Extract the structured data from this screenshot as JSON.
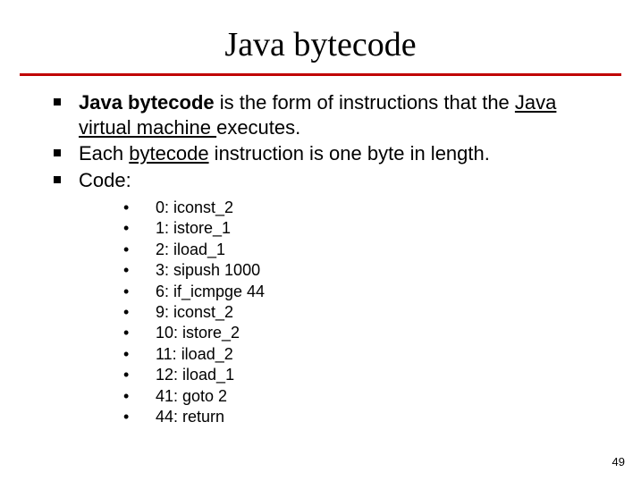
{
  "title": "Java bytecode",
  "bullets": {
    "b1": {
      "bold": "Java bytecode",
      "rest1": " is the form of instructions that the ",
      "link": "Java virtual machine ",
      "rest2": "executes."
    },
    "b2": {
      "pre": "Each ",
      "link": "bytecode",
      "post": " instruction is one byte in length."
    },
    "b3": "Code:"
  },
  "code": [
    "0: iconst_2",
    "1: istore_1",
    "2: iload_1",
    "3: sipush 1000",
    "6: if_icmpge 44",
    "9: iconst_2",
    "10: istore_2",
    "11: iload_2",
    "12: iload_1",
    "41: goto 2",
    "44: return"
  ],
  "page_number": "49"
}
